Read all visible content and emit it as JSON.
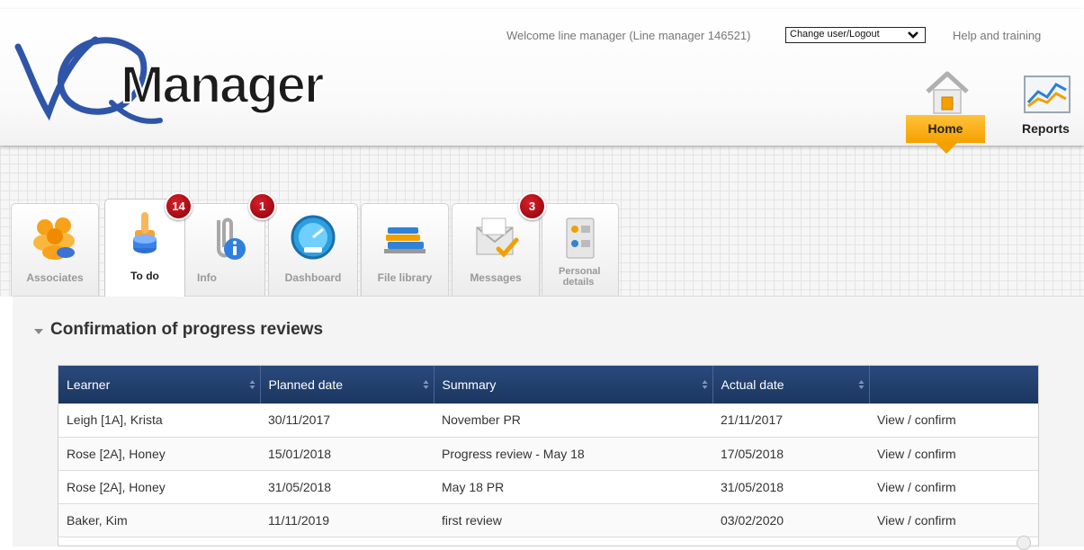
{
  "header": {
    "welcome": "Welcome line manager (Line manager 146521)",
    "user_select": "Change user/Logout",
    "help": "Help and training",
    "nav": {
      "home": "Home",
      "reports": "Reports"
    }
  },
  "tabs": [
    {
      "label": "Associates",
      "badge": ""
    },
    {
      "label": "To do",
      "badge": "14",
      "active": true
    },
    {
      "label": "Info",
      "badge": "1"
    },
    {
      "label": "Dashboard",
      "badge": ""
    },
    {
      "label": "File library",
      "badge": ""
    },
    {
      "label": "Messages",
      "badge": "3"
    },
    {
      "label": "Personal details",
      "badge": ""
    }
  ],
  "section": {
    "title": "Confirmation of progress reviews",
    "columns": [
      "Learner",
      "Planned date",
      "Summary",
      "Actual date",
      ""
    ],
    "rows": [
      {
        "learner": "Leigh [1A], Krista",
        "planned": "30/11/2017",
        "summary": "November PR",
        "actual": "21/11/2017",
        "action": "View / confirm"
      },
      {
        "learner": "Rose [2A], Honey",
        "planned": "15/01/2018",
        "summary": "Progress review - May 18",
        "actual": "17/05/2018",
        "action": "View / confirm"
      },
      {
        "learner": "Rose [2A], Honey",
        "planned": "31/05/2018",
        "summary": "May 18 PR",
        "actual": "31/05/2018",
        "action": "View / confirm"
      },
      {
        "learner": "Baker, Kim",
        "planned": "11/11/2019",
        "summary": "first review",
        "actual": "03/02/2020",
        "action": "View / confirm"
      }
    ]
  },
  "colors": {
    "header_blue": "#1b3660",
    "home_orange": "#f5a000",
    "badge_red": "#c0141c"
  }
}
